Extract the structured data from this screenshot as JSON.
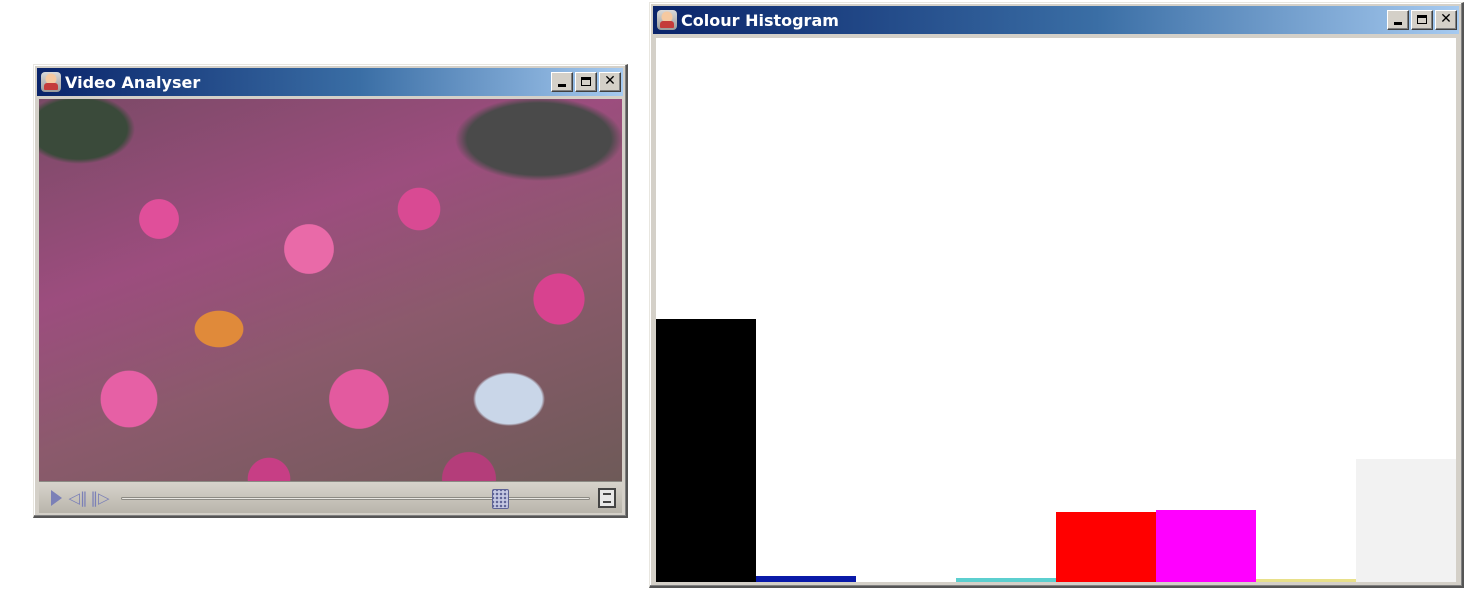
{
  "video_window": {
    "title": "Video Analyser",
    "position_fraction": 0.82
  },
  "histogram_window": {
    "title": "Colour Histogram"
  },
  "chart_data": {
    "type": "bar",
    "categories": [
      "black",
      "blue",
      "green",
      "cyan",
      "red",
      "magenta",
      "yellow",
      "white"
    ],
    "colors": [
      "#000000",
      "#0a1aa8",
      "#2fa52f",
      "#5ccfcf",
      "#ff0000",
      "#ff00ff",
      "#e8e08a",
      "#f2f2f2"
    ],
    "values": [
      263,
      6,
      0,
      4,
      70,
      72,
      3,
      123
    ],
    "ylim": [
      0,
      544
    ],
    "title": "",
    "xlabel": "",
    "ylabel": "",
    "grid": false,
    "legend": "none"
  }
}
